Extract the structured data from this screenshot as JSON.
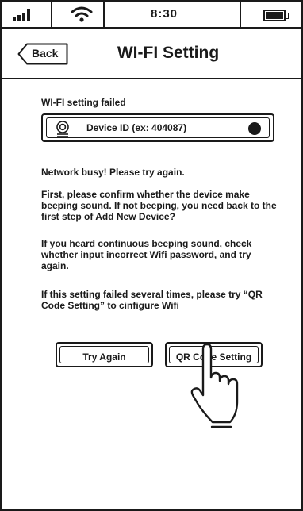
{
  "status_bar": {
    "time": "8:30",
    "icons": [
      "signal-icon",
      "wifi-icon",
      "battery-icon"
    ]
  },
  "nav": {
    "back_label": "Back",
    "title": "WI-FI Setting"
  },
  "content": {
    "section_label": "WI-FI setting failed",
    "device_id_label": "Device ID (ex: 404087)",
    "message_busy": "Network busy! Please try again.",
    "message_confirm": "First, please confirm whether the device make beeping sound. If not beeping, you need back to the first step of Add New Device?",
    "message_password": "If you heard continuous beeping sound, check whether input incorrect Wifi password, and try again.",
    "message_qr": "If this setting failed several times, please try “QR Code Setting” to cinfigure Wifi"
  },
  "actions": {
    "try_again_label": "Try Again",
    "qr_code_label": "QR Code Setting"
  }
}
